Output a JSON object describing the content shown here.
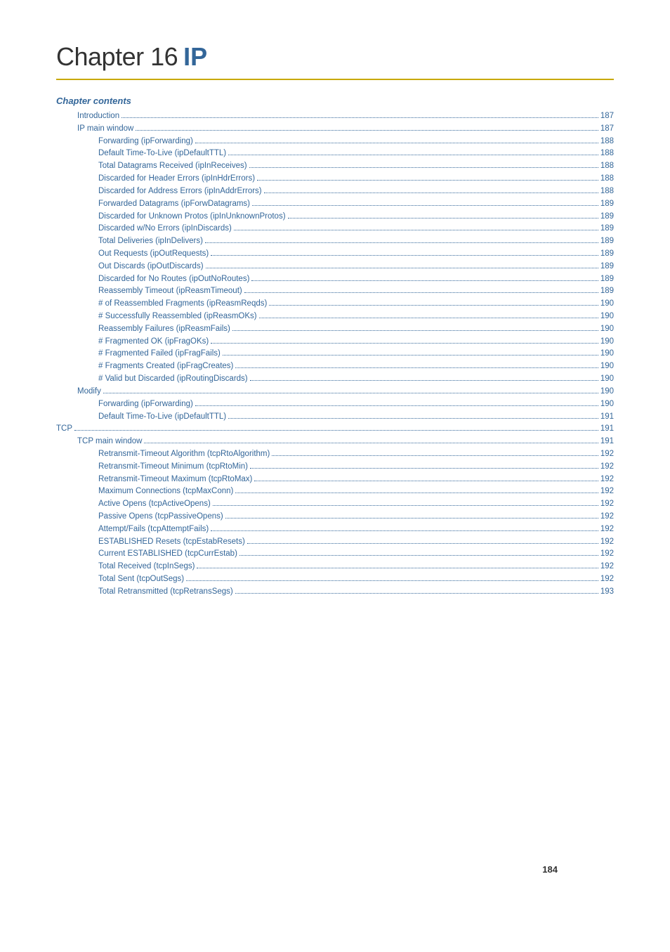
{
  "chapter": {
    "number": "Chapter 16",
    "title_bold": "IP",
    "contents_label": "Chapter contents",
    "page_footer": "184"
  },
  "toc": [
    {
      "text": "Introduction",
      "page": "187",
      "indent": 1
    },
    {
      "text": "IP main window",
      "page": "187",
      "indent": 1
    },
    {
      "text": "Forwarding (ipForwarding)",
      "page": "188",
      "indent": 2
    },
    {
      "text": "Default Time-To-Live (ipDefaultTTL)",
      "page": "188",
      "indent": 2
    },
    {
      "text": "Total Datagrams Received (ipInReceives)",
      "page": "188",
      "indent": 2
    },
    {
      "text": "Discarded for Header Errors (ipInHdrErrors)",
      "page": "188",
      "indent": 2
    },
    {
      "text": "Discarded for Address Errors (ipInAddrErrors)",
      "page": "188",
      "indent": 2
    },
    {
      "text": "Forwarded Datagrams (ipForwDatagrams)",
      "page": "189",
      "indent": 2
    },
    {
      "text": "Discarded for Unknown Protos (ipInUnknownProtos)",
      "page": "189",
      "indent": 2
    },
    {
      "text": "Discarded w/No Errors (ipInDiscards)",
      "page": "189",
      "indent": 2
    },
    {
      "text": "Total Deliveries (ipInDelivers)",
      "page": "189",
      "indent": 2
    },
    {
      "text": "Out Requests (ipOutRequests)",
      "page": "189",
      "indent": 2
    },
    {
      "text": "Out Discards (ipOutDiscards)",
      "page": "189",
      "indent": 2
    },
    {
      "text": "Discarded for No Routes (ipOutNoRoutes)",
      "page": "189",
      "indent": 2
    },
    {
      "text": "Reassembly Timeout (ipReasmTimeout)",
      "page": "189",
      "indent": 2
    },
    {
      "text": "# of Reassembled Fragments (ipReasmReqds)",
      "page": "190",
      "indent": 2
    },
    {
      "text": "# Successfully Reassembled (ipReasmOKs)",
      "page": "190",
      "indent": 2
    },
    {
      "text": "Reassembly Failures (ipReasmFails)",
      "page": "190",
      "indent": 2
    },
    {
      "text": "# Fragmented OK (ipFragOKs)",
      "page": "190",
      "indent": 2
    },
    {
      "text": "# Fragmented Failed (ipFragFails)",
      "page": "190",
      "indent": 2
    },
    {
      "text": "# Fragments Created (ipFragCreates)",
      "page": "190",
      "indent": 2
    },
    {
      "text": "# Valid but Discarded (ipRoutingDiscards)",
      "page": "190",
      "indent": 2
    },
    {
      "text": "Modify",
      "page": "190",
      "indent": 1
    },
    {
      "text": "Forwarding (ipForwarding)",
      "page": "190",
      "indent": 2
    },
    {
      "text": "Default Time-To-Live (ipDefaultTTL)",
      "page": "191",
      "indent": 2
    },
    {
      "text": "TCP",
      "page": "191",
      "indent": 0
    },
    {
      "text": "TCP main window",
      "page": "191",
      "indent": 1
    },
    {
      "text": "Retransmit-Timeout Algorithm (tcpRtoAlgorithm)",
      "page": "192",
      "indent": 2
    },
    {
      "text": "Retransmit-Timeout Minimum (tcpRtoMin)",
      "page": "192",
      "indent": 2
    },
    {
      "text": "Retransmit-Timeout Maximum (tcpRtoMax)",
      "page": "192",
      "indent": 2
    },
    {
      "text": "Maximum Connections (tcpMaxConn)",
      "page": "192",
      "indent": 2
    },
    {
      "text": "Active Opens (tcpActiveOpens)",
      "page": "192",
      "indent": 2
    },
    {
      "text": "Passive Opens (tcpPassiveOpens)",
      "page": "192",
      "indent": 2
    },
    {
      "text": "Attempt/Fails (tcpAttemptFails)",
      "page": "192",
      "indent": 2
    },
    {
      "text": "ESTABLISHED Resets (tcpEstabResets)",
      "page": "192",
      "indent": 2
    },
    {
      "text": "Current ESTABLISHED (tcpCurrEstab)",
      "page": "192",
      "indent": 2
    },
    {
      "text": "Total Received (tcpInSegs)",
      "page": "192",
      "indent": 2
    },
    {
      "text": "Total Sent (tcpOutSegs)",
      "page": "192",
      "indent": 2
    },
    {
      "text": "Total Retransmitted (tcpRetransSegs)",
      "page": "193",
      "indent": 2
    }
  ]
}
